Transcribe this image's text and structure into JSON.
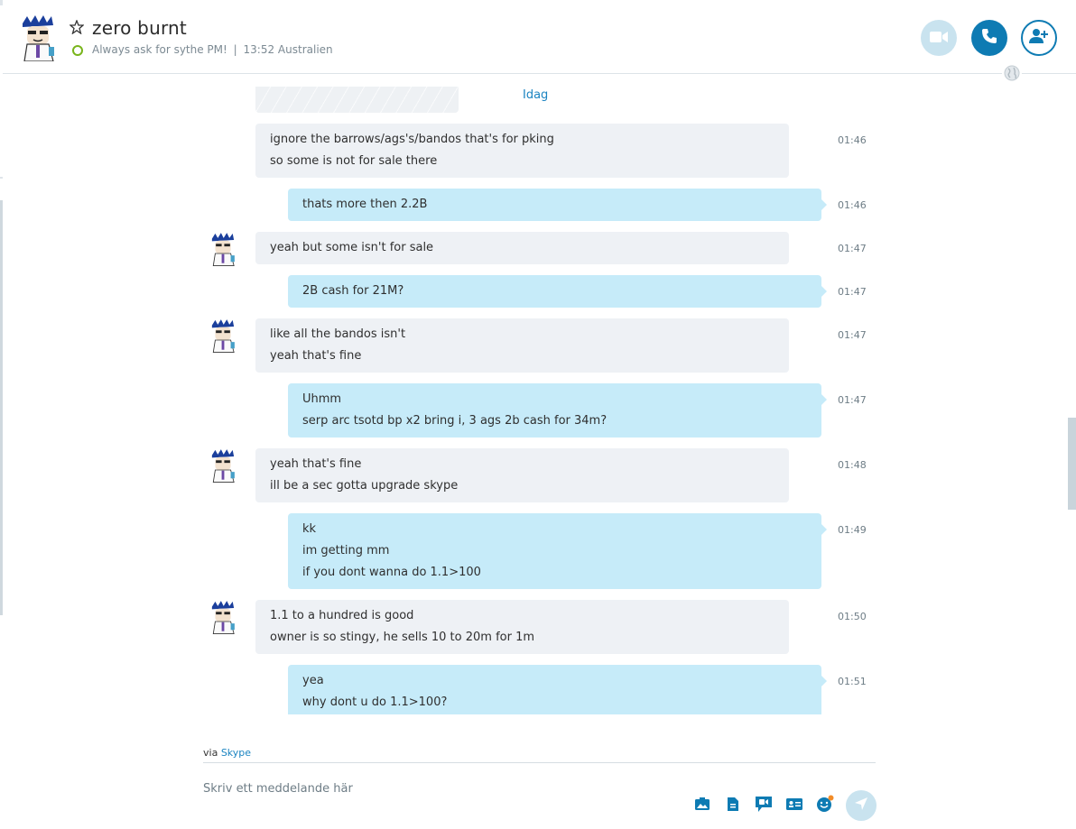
{
  "header": {
    "contact_name": "zero burnt",
    "mood_message": "Always ask for sythe PM!",
    "separator": "|",
    "local_time": "13:52 Australien"
  },
  "colors": {
    "accent": "#0e7bb3",
    "incoming_bubble": "#eef1f5",
    "outgoing_bubble": "#c6ebf9",
    "online_status": "#79b51c"
  },
  "conversation": {
    "day_label": "Idag",
    "messages": [
      {
        "direction": "in",
        "show_avatar": false,
        "lines": [
          "ignore the barrows/ags's/bandos that's for pking",
          "so some is not for sale there"
        ],
        "time": "01:46"
      },
      {
        "direction": "out",
        "lines": [
          "thats more then 2.2B"
        ],
        "time": "01:46"
      },
      {
        "direction": "in",
        "show_avatar": true,
        "lines": [
          "yeah but some isn't for sale"
        ],
        "time": "01:47"
      },
      {
        "direction": "out",
        "lines": [
          "2B cash for 21M?"
        ],
        "time": "01:47"
      },
      {
        "direction": "in",
        "show_avatar": true,
        "lines": [
          "like all the bandos isn't",
          "yeah that's fine"
        ],
        "time": "01:47"
      },
      {
        "direction": "out",
        "lines": [
          "Uhmm",
          "serp arc tsotd bp x2 bring i, 3 ags 2b cash for 34m?"
        ],
        "time": "01:47"
      },
      {
        "direction": "in",
        "show_avatar": true,
        "lines": [
          "yeah that's fine",
          "ill be a sec gotta upgrade skype"
        ],
        "time": "01:48"
      },
      {
        "direction": "out",
        "lines": [
          "kk",
          "im getting mm",
          "if you dont wanna do 1.1>100"
        ],
        "time": "01:49"
      },
      {
        "direction": "in",
        "show_avatar": true,
        "lines": [
          "1.1 to a hundred is good",
          "owner is so stingy, he sells 10 to 20m for 1m"
        ],
        "time": "01:50"
      },
      {
        "direction": "out",
        "lines": [
          "yea",
          "why dont u do 1.1>100?"
        ],
        "time": "01:51"
      }
    ]
  },
  "composer": {
    "via_prefix": "via",
    "via_service": "Skype",
    "placeholder": "Skriv ett meddelande här"
  },
  "icons": {
    "header": [
      "star-icon",
      "video-call-icon",
      "audio-call-icon",
      "add-contact-icon",
      "globe-icon"
    ],
    "toolbar": [
      "media-icon",
      "file-icon",
      "video-message-icon",
      "contact-card-icon",
      "emoticon-icon",
      "send-icon"
    ]
  }
}
